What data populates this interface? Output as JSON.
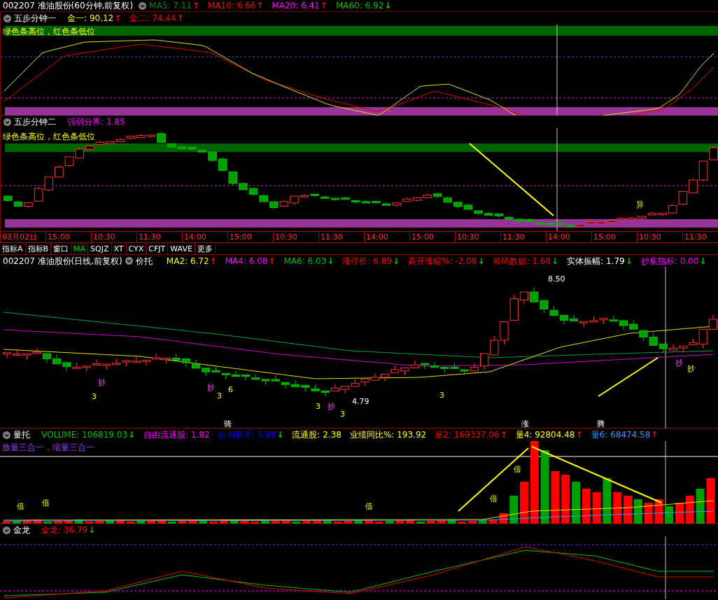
{
  "header": {
    "title": "002207 准油股份(60分钟,前复权)",
    "indicators": [
      {
        "label": "MA5:",
        "value": "7.11",
        "color": "#008000",
        "arrow": "↑",
        "rising": true
      },
      {
        "label": "MA10:",
        "value": "6.66",
        "color": "#ff0000",
        "arrow": "↑",
        "rising": true
      },
      {
        "label": "MA20:",
        "value": "6.41",
        "color": "#ff00ff",
        "arrow": "↑",
        "rising": true
      },
      {
        "label": "MA60:",
        "value": "6.92",
        "color": "#00c000",
        "arrow": "↓",
        "rising": false
      }
    ]
  },
  "panel_1": {
    "title": "五步分钟一",
    "note": "绿色条高位，红色条低位",
    "indicators": [
      {
        "label": "金一:",
        "value": "90.12",
        "color": "#ffff00",
        "arrow": "↑",
        "rising": true
      },
      {
        "label": "金二:",
        "value": "74.44",
        "color": "#ff0000",
        "arrow": "↑",
        "rising": true
      }
    ]
  },
  "panel_2": {
    "title": "五步分钟二",
    "note": "绿色条高位，红色条低位",
    "indicators": [
      {
        "label": "强弱分界:",
        "value": "1.85",
        "color": "#ff00ff"
      }
    ],
    "annotations": [
      "异"
    ]
  },
  "time_axis": [
    "03月02日",
    "15:00",
    "10:30",
    "11:30",
    "14:00",
    "15:00",
    "10:30",
    "11:30",
    "14:00",
    "15:00",
    "10:30",
    "11:30",
    "14:00",
    "15:00",
    "10:30",
    "11:30"
  ],
  "tabs": [
    {
      "label": "指标A",
      "selected": false
    },
    {
      "label": "指标B",
      "selected": false
    },
    {
      "label": "窗口",
      "selected": false
    },
    {
      "label": "MA",
      "selected": true
    },
    {
      "label": "SQJZ",
      "selected": false
    },
    {
      "label": "XT",
      "selected": false
    },
    {
      "label": "CYX",
      "selected": false
    },
    {
      "label": "CFJT",
      "selected": false
    },
    {
      "label": "WAVE",
      "selected": false
    },
    {
      "label": "更多",
      "selected": false
    }
  ],
  "main_chart": {
    "title": "002207 准油股份(日线,前复权)",
    "subtitle": "价托",
    "indicators": [
      {
        "label": "MA2:",
        "value": "6.72",
        "color": "#ffff00",
        "arrow": "↑",
        "rising": true
      },
      {
        "label": "MA4:",
        "value": "6.08",
        "color": "#ff00ff",
        "arrow": "↑",
        "rising": true
      },
      {
        "label": "MA6:",
        "value": "6.03",
        "color": "#00c000",
        "arrow": "↓",
        "rising": false
      },
      {
        "label": "涨停价:",
        "value": "6.89",
        "color": "#ff0000",
        "arrow": "↓",
        "rising": false
      },
      {
        "label": "高开涨幅%:",
        "value": "-2.08",
        "color": "#ff0000",
        "arrow": "↓",
        "rising": false
      },
      {
        "label": "筹码数据:",
        "value": "1.68",
        "color": "#ff0000",
        "arrow": "↓",
        "rising": false
      },
      {
        "label": "实体振幅:",
        "value": "1.79",
        "color": "#ffffff",
        "arrow": "↓",
        "rising": false
      },
      {
        "label": "抄底指标:",
        "value": "0.00",
        "color": "#ff00ff",
        "arrow": "↓",
        "rising": false
      }
    ],
    "annotations": [
      "8.50",
      "4.79",
      "抄",
      "抄",
      "6",
      "3",
      "3",
      "3",
      "抄",
      "3",
      "3",
      "抄",
      "抄",
      "骑",
      "涨",
      "腾"
    ]
  },
  "volume_panel": {
    "title": "量托",
    "note": "放量三合一，缩量三合一",
    "indicators": [
      {
        "label": "VOLUME:",
        "value": "106819.03",
        "color": "#00c000",
        "arrow": "↓",
        "rising": false
      },
      {
        "label": "自由流通股:",
        "value": "1.82",
        "color": "#ff00ff"
      },
      {
        "label": "自由换手:",
        "value": "5.88",
        "color": "#0000ff",
        "arrow": "↓",
        "rising": false
      },
      {
        "label": "流通股:",
        "value": "2.38",
        "color": "#ffff00"
      },
      {
        "label": "业绩同比%:",
        "value": "193.92",
        "color": "#ffff00"
      },
      {
        "label": "量2:",
        "value": "169337.06",
        "color": "#ff0000",
        "arrow": "↑",
        "rising": true
      },
      {
        "label": "量4:",
        "value": "92804.48",
        "color": "#ffff00",
        "arrow": "↑",
        "rising": true
      },
      {
        "label": "量6:",
        "value": "68474.58",
        "color": "#3399ff",
        "arrow": "↑",
        "rising": true
      }
    ],
    "annotations": [
      "倍",
      "倍",
      "倍",
      "倍",
      "倍"
    ]
  },
  "bottom_panel": {
    "title": "金龙",
    "indicators": [
      {
        "label": "金龙:",
        "value": "36.79",
        "color": "#ff0000",
        "arrow": "↓",
        "rising": false
      }
    ]
  }
}
